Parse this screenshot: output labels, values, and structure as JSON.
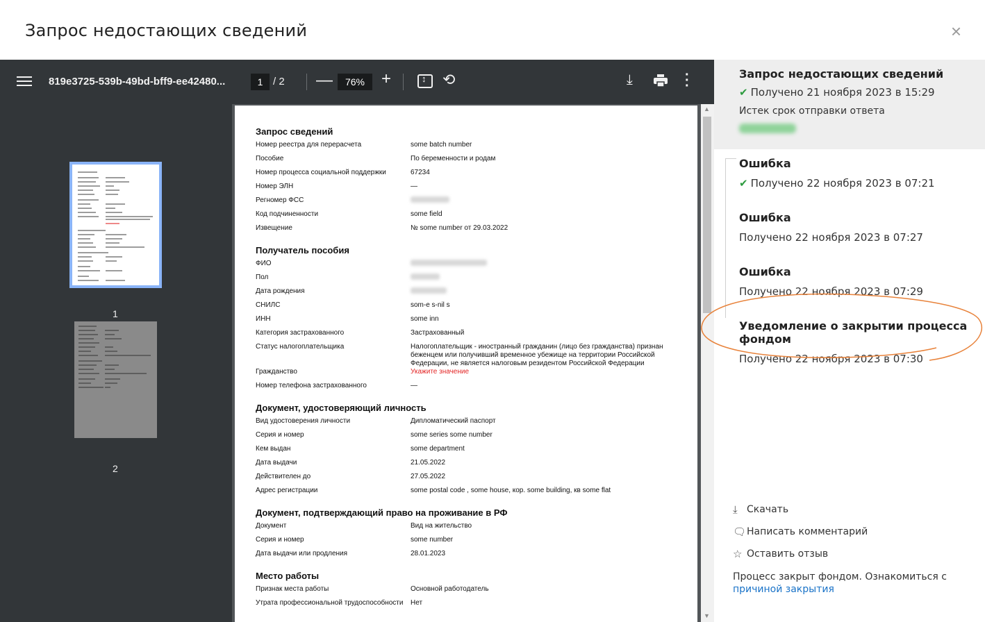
{
  "modal": {
    "title": "Запрос недостающих сведений",
    "close": "×"
  },
  "viewer": {
    "filename": "819e3725-539b-49bd-bff9-ee42480...",
    "page_current": "1",
    "page_total": "/ 2",
    "zoom": "76%",
    "thumb_labels": [
      "1",
      "2"
    ]
  },
  "pdf": {
    "sections": [
      {
        "title": "Запрос сведений",
        "rows": [
          {
            "k": "Номер реестра для перерасчета",
            "v": "some batch number"
          },
          {
            "k": "Пособие",
            "v": "По беременности и родам"
          },
          {
            "k": "Номер процесса социальной поддержки",
            "v": "67234"
          },
          {
            "k": "Номер ЭЛН",
            "v": "—"
          },
          {
            "k": "Регномер ФСС",
            "v": ""
          },
          {
            "k": "Код подчиненности",
            "v": "some field"
          },
          {
            "k": "Извещение",
            "v": "№ some number от 29.03.2022"
          }
        ]
      },
      {
        "title": "Получатель пособия",
        "rows": [
          {
            "k": "ФИО",
            "v": ""
          },
          {
            "k": "Пол",
            "v": ""
          },
          {
            "k": "Дата рождения",
            "v": ""
          },
          {
            "k": "СНИЛС",
            "v": "som-e s-nil s"
          },
          {
            "k": "ИНН",
            "v": "some inn"
          },
          {
            "k": "Категория застрахованного",
            "v": "Застрахованный"
          },
          {
            "k": "Статус налогоплательщика",
            "v": "Налогоплательщик - иностранный гражданин (лицо без гражданства) признан беженцем или получивший временное убежище на территории Российской Федерации, не является налоговым резидентом Российской Федерации"
          },
          {
            "k": "Гражданство",
            "v": "Укажите значение",
            "red": true
          },
          {
            "k": "Номер телефона застрахованного",
            "v": "—"
          }
        ]
      },
      {
        "title": "Документ, удостоверяющий личность",
        "rows": [
          {
            "k": "Вид удостоверения личности",
            "v": "Дипломатический паспорт"
          },
          {
            "k": "Серия и номер",
            "v": "some series some number"
          },
          {
            "k": "Кем выдан",
            "v": "some department"
          },
          {
            "k": "Дата выдачи",
            "v": "21.05.2022"
          },
          {
            "k": "Действителен до",
            "v": "27.05.2022"
          },
          {
            "k": "Адрес регистрации",
            "v": "some postal code  , some house, кор. some building, кв some flat"
          }
        ]
      },
      {
        "title": "Документ, подтверждающий право на проживание в РФ",
        "rows": [
          {
            "k": "Документ",
            "v": "Вид на жительство"
          },
          {
            "k": "Серия и номер",
            "v": "some number"
          },
          {
            "k": "Дата выдачи или продления",
            "v": "28.01.2023"
          }
        ]
      },
      {
        "title": "Место работы",
        "rows": [
          {
            "k": "Признак места работы",
            "v": "Основной работодатель"
          },
          {
            "k": "Утрата профессиональной трудоспособности",
            "v": "Нет"
          }
        ]
      }
    ]
  },
  "panel": {
    "items": [
      {
        "title": "Запрос недостающих сведений",
        "sub": "Получено 21 ноября 2023 в 15:29",
        "checked": true,
        "extra": "Истек срок отправки ответа"
      },
      {
        "title": "Ошибка",
        "sub": "Получено 22 ноября 2023 в 07:21",
        "checked": true
      },
      {
        "title": "Ошибка",
        "sub": "Получено 22 ноября 2023 в 07:27"
      },
      {
        "title": "Ошибка",
        "sub": "Получено 22 ноября 2023 в 07:29"
      },
      {
        "title": "Уведомление о закрытии процесса фондом",
        "sub": "Получено 22 ноября 2023 в 07:30"
      }
    ],
    "actions": {
      "download": "Скачать",
      "comment": "Написать комментарий",
      "review": "Оставить отзыв"
    },
    "closed_note": "Процесс закрыт фондом. Ознакомиться с",
    "closed_link": "причиной закрытия"
  }
}
